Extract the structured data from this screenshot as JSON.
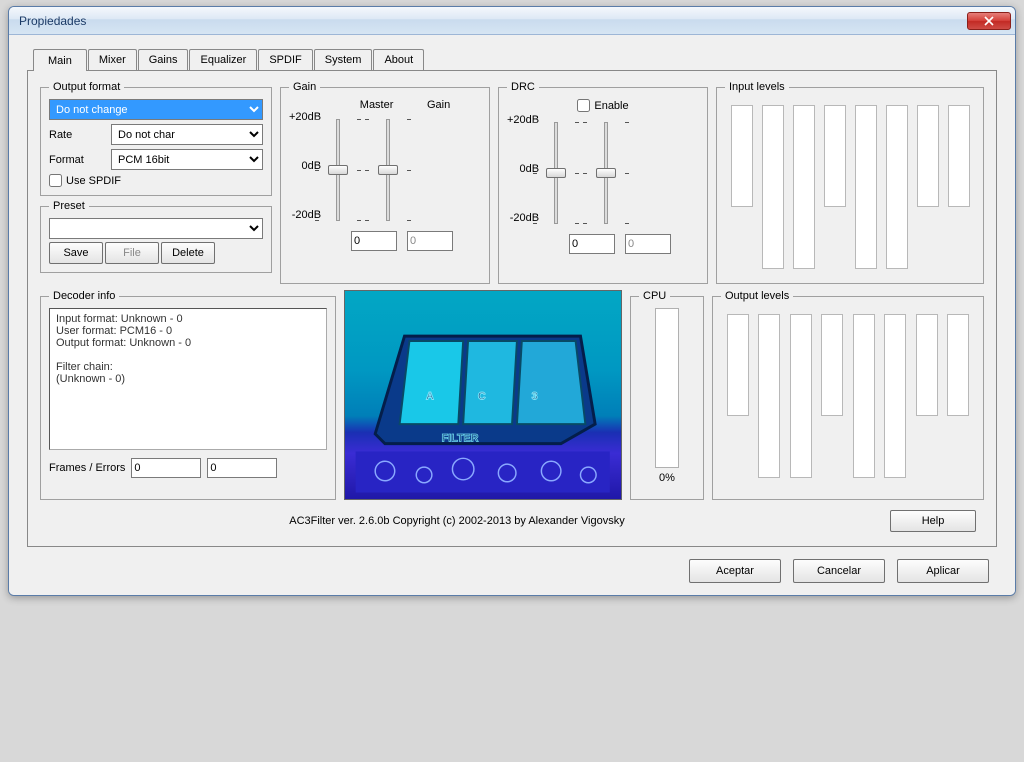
{
  "window": {
    "title": "Propiedades"
  },
  "tabs": [
    "Main",
    "Mixer",
    "Gains",
    "Equalizer",
    "SPDIF",
    "System",
    "About"
  ],
  "output_format": {
    "legend": "Output format",
    "main_select": "Do not change",
    "rate_label": "Rate",
    "rate_value": "Do not char",
    "format_label": "Format",
    "format_value": "PCM 16bit",
    "use_spdif": "Use SPDIF"
  },
  "preset": {
    "legend": "Preset",
    "value": "",
    "save": "Save",
    "file": "File",
    "delete": "Delete"
  },
  "gain": {
    "legend": "Gain",
    "master": "Master",
    "gain": "Gain",
    "scale": [
      "+20dB",
      "0dB",
      "-20dB"
    ],
    "master_val": "0",
    "gain_val": "0"
  },
  "drc": {
    "legend": "DRC",
    "enable": "Enable",
    "scale": [
      "+20dB",
      "0dB",
      "-20dB"
    ],
    "val1": "0",
    "val2": "0"
  },
  "input_levels": {
    "legend": "Input levels"
  },
  "output_levels": {
    "legend": "Output levels"
  },
  "cpu": {
    "legend": "CPU",
    "value": "0%"
  },
  "decoder": {
    "legend": "Decoder info",
    "text": "Input format: Unknown - 0\nUser format: PCM16 - 0\nOutput format: Unknown - 0\n\nFilter chain:\n(Unknown - 0)",
    "frames_label": "Frames / Errors",
    "frames": "0",
    "errors": "0"
  },
  "footer": {
    "copyright": "AC3Filter ver. 2.6.0b Copyright (c) 2002-2013 by Alexander Vigovsky",
    "help": "Help"
  },
  "buttons": {
    "ok": "Aceptar",
    "cancel": "Cancelar",
    "apply": "Aplicar"
  }
}
